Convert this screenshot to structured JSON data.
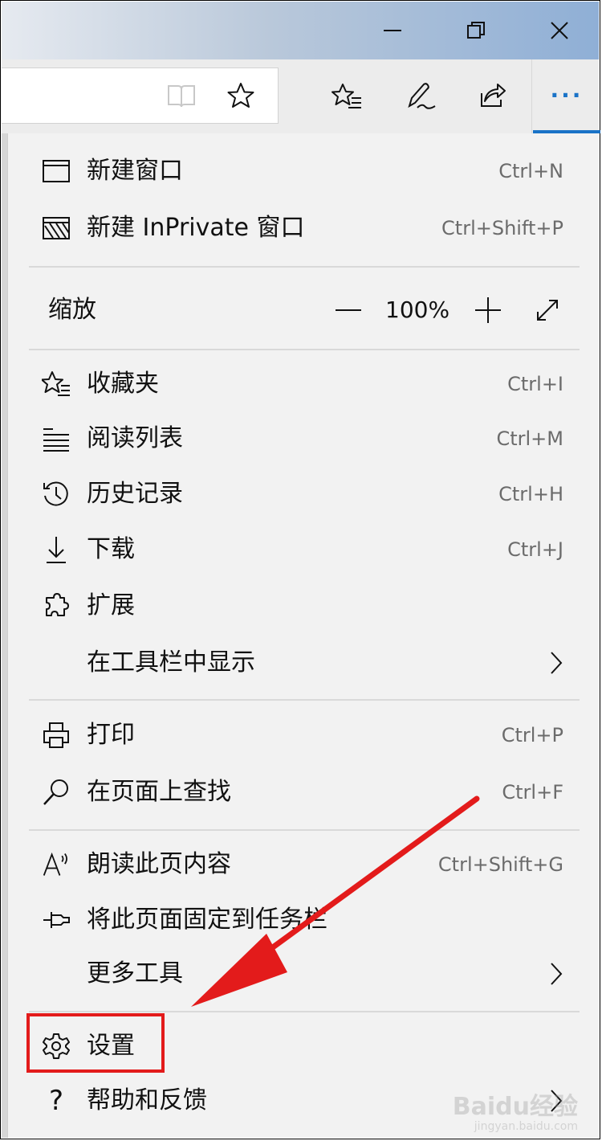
{
  "window": {
    "minimize_icon": "minimize-icon",
    "maximize_icon": "restore-icon",
    "close_icon": "close-icon"
  },
  "toolbar": {
    "reading_view_icon": "reading-view-icon",
    "favorite_icon": "star-icon",
    "favorites_hub_icon": "favorites-hub-icon",
    "web_note_icon": "pen-icon",
    "share_icon": "share-icon",
    "more_label": "···"
  },
  "menu": {
    "new_window": {
      "label": "新建窗口",
      "shortcut": "Ctrl+N"
    },
    "new_inprivate": {
      "label": "新建 InPrivate 窗口",
      "shortcut": "Ctrl+Shift+P"
    },
    "zoom": {
      "label": "缩放",
      "minus": "—",
      "value": "100%",
      "plus": "+",
      "fullscreen_icon": "fullscreen-icon"
    },
    "favorites": {
      "label": "收藏夹",
      "shortcut": "Ctrl+I"
    },
    "reading_list": {
      "label": "阅读列表",
      "shortcut": "Ctrl+M"
    },
    "history": {
      "label": "历史记录",
      "shortcut": "Ctrl+H"
    },
    "downloads": {
      "label": "下载",
      "shortcut": "Ctrl+J"
    },
    "extensions": {
      "label": "扩展"
    },
    "show_in_toolbar": {
      "label": "在工具栏中显示"
    },
    "print": {
      "label": "打印",
      "shortcut": "Ctrl+P"
    },
    "find": {
      "label": "在页面上查找",
      "shortcut": "Ctrl+F"
    },
    "read_aloud": {
      "label": "朗读此页内容",
      "shortcut": "Ctrl+Shift+G"
    },
    "pin_taskbar": {
      "label": "将此页面固定到任务栏"
    },
    "more_tools": {
      "label": "更多工具"
    },
    "settings": {
      "label": "设置"
    },
    "help": {
      "label": "帮助和反馈"
    }
  },
  "annotation": {
    "highlight_color": "#e31b1b",
    "arrow_color": "#e31b1b"
  },
  "watermark": {
    "line1": "Baidu经验",
    "line2": "jingyan.baidu.com"
  },
  "colors": {
    "accent": "#1a73c7",
    "menu_bg": "#f2f2f2"
  }
}
